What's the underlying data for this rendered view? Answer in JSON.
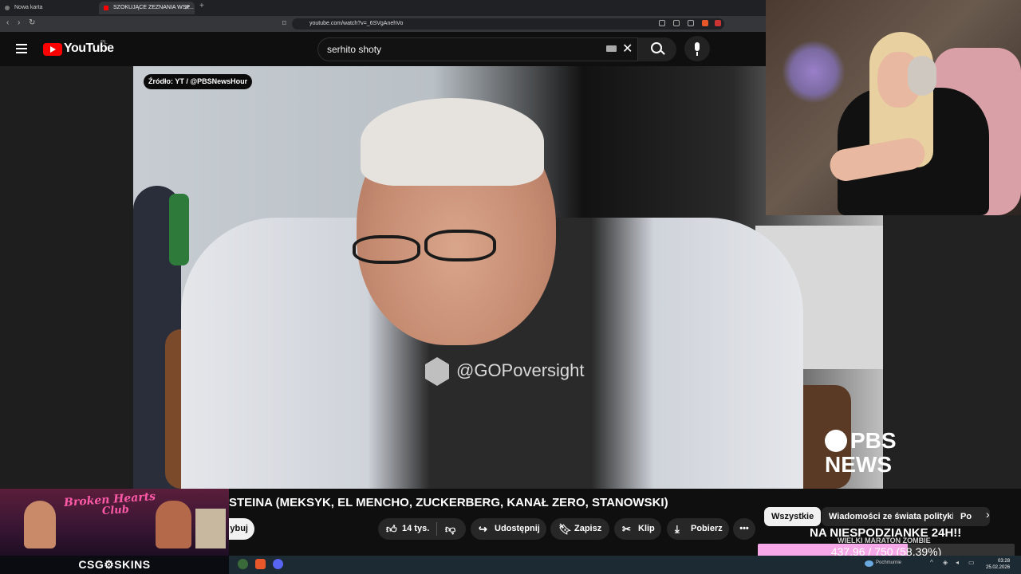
{
  "browser": {
    "tabs": [
      {
        "label": "Nowa karta"
      },
      {
        "label": "SZOKUJĄCE ZEZNANIA WSP..."
      }
    ],
    "url": "youtube.com/watch?v=_6SVgAnehVo"
  },
  "youtube": {
    "logo_text": "YouTube",
    "country_code": "PL",
    "search_value": "serhito shoty"
  },
  "video": {
    "source_badge": "Źródło: YT / @PBSNewsHour",
    "watermark": "@GOPoversight",
    "pbs_line1": "PBS",
    "pbs_line2": "NEWS",
    "title": "STEINA (MEKSYK, EL MENCHO, ZUCKERBERG, KANAŁ ZERO, STANOWSKI)",
    "subscribe_partial": "ybuj",
    "actions": {
      "likes": "14 tys.",
      "share": "Udostępnij",
      "save": "Zapisz",
      "clip": "Klip",
      "download": "Pobierz",
      "more": "•••"
    }
  },
  "chips": [
    "Wszystkie",
    "Wiadomości ze świata polityki",
    "Po"
  ],
  "stream_overlay": {
    "text": "NA NIESPODZIANKE 24H!!",
    "subtext": "WIELKI MARATON ZOMBIE",
    "goal_text": "437.96 / 750 (58.39%)",
    "goal_fraction": 0.5839,
    "goal_color": "#f7a8e8"
  },
  "banner": {
    "title_line1": "Broken Hearts",
    "title_line2": "Club",
    "sponsor": "CSG⚙SKINS"
  },
  "taskbar": {
    "weather": "Pochmurnie",
    "time": "03:28",
    "date": "25.02.2026"
  },
  "colors": {
    "youtube_red": "#ff0000",
    "background": "#0f0f0f"
  }
}
